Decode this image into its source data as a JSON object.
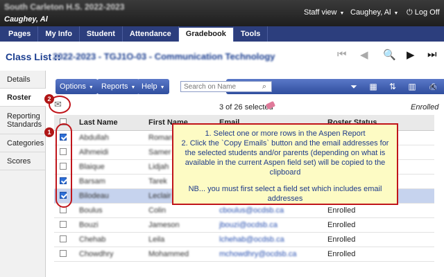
{
  "header": {
    "school_name": "South Carleton H.S. 2022-2023",
    "user_subtitle": "Caughey, Al",
    "staff_view": "Staff view",
    "user_menu": "Caughey, Al",
    "log_off": "Log Off"
  },
  "tabs": [
    "Pages",
    "My Info",
    "Student",
    "Attendance",
    "Gradebook",
    "Tools"
  ],
  "active_tab": "Gradebook",
  "title": {
    "prefix": "Class List ::",
    "blurred": "2022-2023 - TGJ1O-03 - Communication Technology"
  },
  "sidebar": [
    "Details",
    "Roster",
    "Reporting Standards",
    "Categories",
    "Scores"
  ],
  "toolbar": {
    "options": "Options",
    "reports": "Reports",
    "help": "Help",
    "search_placeholder": "Search on Name"
  },
  "selection_info": "3 of 26 selected",
  "enrolled_filter": "Enrolled",
  "badges": {
    "copy": "2",
    "select": "1"
  },
  "table": {
    "headers": {
      "last": "Last Name",
      "first": "First Name",
      "email": "Email",
      "status": "Roster Status"
    },
    "rows": [
      {
        "checked": true,
        "selected": false,
        "last": "Abdullah",
        "first": "Roman",
        "email": "",
        "status": ""
      },
      {
        "checked": false,
        "selected": false,
        "last": "Alhmeidi",
        "first": "Samer",
        "email": "",
        "status": ""
      },
      {
        "checked": false,
        "selected": false,
        "last": "Blaique",
        "first": "Lidjah",
        "email": "",
        "status": ""
      },
      {
        "checked": true,
        "selected": false,
        "last": "Barsam",
        "first": "Tarek",
        "email": "",
        "status": ""
      },
      {
        "checked": true,
        "selected": true,
        "last": "Bilodeau",
        "first": "Leclair",
        "email": "",
        "status": ""
      },
      {
        "checked": false,
        "selected": false,
        "last": "Boulus",
        "first": "Colin",
        "email": "cboulus@ocdsb.ca",
        "status": "Enrolled"
      },
      {
        "checked": false,
        "selected": false,
        "last": "Bouzi",
        "first": "Jameson",
        "email": "jbouzi@ocdsb.ca",
        "status": "Enrolled"
      },
      {
        "checked": false,
        "selected": false,
        "last": "Chehab",
        "first": "Leila",
        "email": "lchehab@ocdsb.ca",
        "status": "Enrolled"
      },
      {
        "checked": false,
        "selected": false,
        "last": "Chowdhry",
        "first": "Mohammed",
        "email": "mchowdhry@ocdsb.ca",
        "status": "Enrolled"
      }
    ]
  },
  "callout": {
    "line1": "1. Select one or more rows in the Aspen Report",
    "line2": "2. Click the `Copy Emails` button and the email addresses for the selected students and/or parents (depending on what is available in the current Aspen field set) will be copied to the clipboard",
    "line3": "NB... you must first select a field set which includes email addresses"
  },
  "icons": [
    "first-page-icon",
    "prev-icon",
    "search-icon",
    "next-icon",
    "last-page-icon",
    "filter-icon",
    "grid-icon",
    "sort-icon",
    "chart-icon",
    "print-icon",
    "copy-emails-icon",
    "eraser-icon",
    "expand-icon"
  ]
}
